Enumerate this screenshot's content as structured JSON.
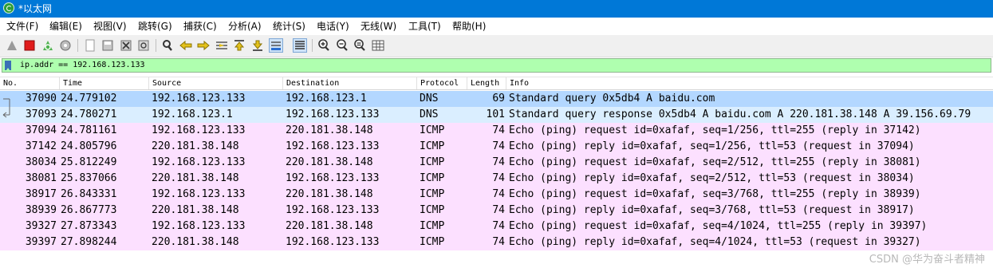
{
  "window": {
    "title": "*以太网",
    "icon": "wireshark-fin-icon",
    "titlebar_color": "#0078d7"
  },
  "menu": [
    "文件(F)",
    "编辑(E)",
    "视图(V)",
    "跳转(G)",
    "捕获(C)",
    "分析(A)",
    "统计(S)",
    "电话(Y)",
    "无线(W)",
    "工具(T)",
    "帮助(H)"
  ],
  "toolbar": [
    "start-capture-icon",
    "stop-capture-icon",
    "restart-capture-icon",
    "capture-options-icon",
    "open-file-icon",
    "save-file-icon",
    "close-file-icon",
    "reload-icon",
    "find-packet-icon",
    "go-back-icon",
    "go-forward-icon",
    "go-to-packet-icon",
    "first-packet-icon",
    "last-packet-icon",
    "autoscroll-icon",
    "colorize-icon",
    "zoom-in-icon",
    "zoom-out-icon",
    "normal-size-icon",
    "resize-columns-icon"
  ],
  "filter": {
    "value": "ip.addr == 192.168.123.133",
    "background": "#afffaf"
  },
  "columns": [
    "No.",
    "Time",
    "Source",
    "Destination",
    "Protocol",
    "Length",
    "Info"
  ],
  "colors": {
    "dns_selected": "#b3d7ff",
    "dns": "#daeeff",
    "icmp": "#fce0ff"
  },
  "packets": [
    {
      "no": "37090",
      "time": "24.779102",
      "source": "192.168.123.133",
      "destination": "192.168.123.1",
      "protocol": "DNS",
      "length": "69",
      "info": "Standard query 0x5db4 A baidu.com"
    },
    {
      "no": "37093",
      "time": "24.780271",
      "source": "192.168.123.1",
      "destination": "192.168.123.133",
      "protocol": "DNS",
      "length": "101",
      "info": "Standard query response 0x5db4 A baidu.com A 220.181.38.148 A 39.156.69.79"
    },
    {
      "no": "37094",
      "time": "24.781161",
      "source": "192.168.123.133",
      "destination": "220.181.38.148",
      "protocol": "ICMP",
      "length": "74",
      "info": "Echo (ping) request  id=0xafaf, seq=1/256, ttl=255 (reply in 37142)"
    },
    {
      "no": "37142",
      "time": "24.805796",
      "source": "220.181.38.148",
      "destination": "192.168.123.133",
      "protocol": "ICMP",
      "length": "74",
      "info": "Echo (ping) reply    id=0xafaf, seq=1/256, ttl=53 (request in 37094)"
    },
    {
      "no": "38034",
      "time": "25.812249",
      "source": "192.168.123.133",
      "destination": "220.181.38.148",
      "protocol": "ICMP",
      "length": "74",
      "info": "Echo (ping) request  id=0xafaf, seq=2/512, ttl=255 (reply in 38081)"
    },
    {
      "no": "38081",
      "time": "25.837066",
      "source": "220.181.38.148",
      "destination": "192.168.123.133",
      "protocol": "ICMP",
      "length": "74",
      "info": "Echo (ping) reply    id=0xafaf, seq=2/512, ttl=53 (request in 38034)"
    },
    {
      "no": "38917",
      "time": "26.843331",
      "source": "192.168.123.133",
      "destination": "220.181.38.148",
      "protocol": "ICMP",
      "length": "74",
      "info": "Echo (ping) request  id=0xafaf, seq=3/768, ttl=255 (reply in 38939)"
    },
    {
      "no": "38939",
      "time": "26.867773",
      "source": "220.181.38.148",
      "destination": "192.168.123.133",
      "protocol": "ICMP",
      "length": "74",
      "info": "Echo (ping) reply    id=0xafaf, seq=3/768, ttl=53 (request in 38917)"
    },
    {
      "no": "39327",
      "time": "27.873343",
      "source": "192.168.123.133",
      "destination": "220.181.38.148",
      "protocol": "ICMP",
      "length": "74",
      "info": "Echo (ping) request  id=0xafaf, seq=4/1024, ttl=255 (reply in 39397)"
    },
    {
      "no": "39397",
      "time": "27.898244",
      "source": "220.181.38.148",
      "destination": "192.168.123.133",
      "protocol": "ICMP",
      "length": "74",
      "info": "Echo (ping) reply    id=0xafaf, seq=4/1024, ttl=53 (request in 39327)"
    }
  ],
  "watermark": "CSDN @华为奋斗者精神"
}
